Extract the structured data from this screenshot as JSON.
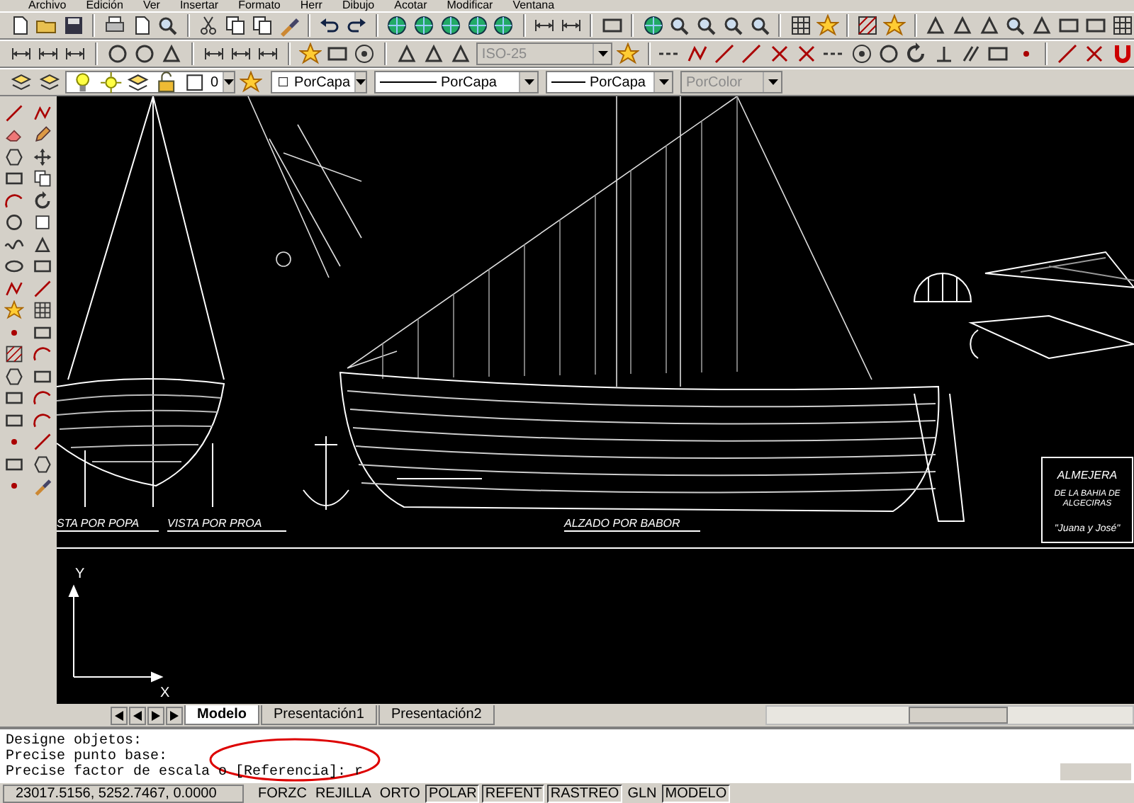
{
  "menu": [
    "Archivo",
    "Edición",
    "Ver",
    "Insertar",
    "Formato",
    "Herr",
    "Dibujo",
    "Acotar",
    "Modificar",
    "Ventana"
  ],
  "dim_style": {
    "value": "ISO-25",
    "disabled": true
  },
  "layer": {
    "value": "0"
  },
  "property_combos": [
    {
      "kind": "color",
      "value": "PorCapa",
      "disabled": false
    },
    {
      "kind": "linetype",
      "value": "PorCapa",
      "disabled": false
    },
    {
      "kind": "lineweight",
      "value": "PorCapa",
      "disabled": false
    },
    {
      "kind": "plotstyle",
      "value": "PorColor",
      "disabled": true
    }
  ],
  "drawing": {
    "view_labels": [
      "STA POR POPA",
      "VISTA POR PROA",
      "ALZADO POR BABOR"
    ],
    "title_block": {
      "title": "ALMEJERA",
      "lines": [
        "DE LA BAHIA DE",
        "ALGECIRAS"
      ],
      "boat_name": "\"Juana y José\""
    },
    "ucs": {
      "y_label": "Y",
      "x_label": "X"
    }
  },
  "layout_tabs": [
    {
      "label": "Modelo",
      "selected": true
    },
    {
      "label": "Presentación1",
      "selected": false
    },
    {
      "label": "Presentación2",
      "selected": false
    }
  ],
  "command_lines": [
    "Designe objetos:",
    "Precise punto base:",
    "Precise factor de escala o [Referencia]: r"
  ],
  "status_bar": {
    "coordinates": "23017.5156, 5252.7467, 0.0000",
    "toggles": [
      {
        "label": "FORZC",
        "on": false
      },
      {
        "label": "REJILLA",
        "on": false
      },
      {
        "label": "ORTO",
        "on": false
      },
      {
        "label": "POLAR",
        "on": true
      },
      {
        "label": "REFENT",
        "on": true
      },
      {
        "label": "RASTREO",
        "on": true
      },
      {
        "label": "GLN",
        "on": false
      },
      {
        "label": "MODELO",
        "on": true
      }
    ]
  }
}
